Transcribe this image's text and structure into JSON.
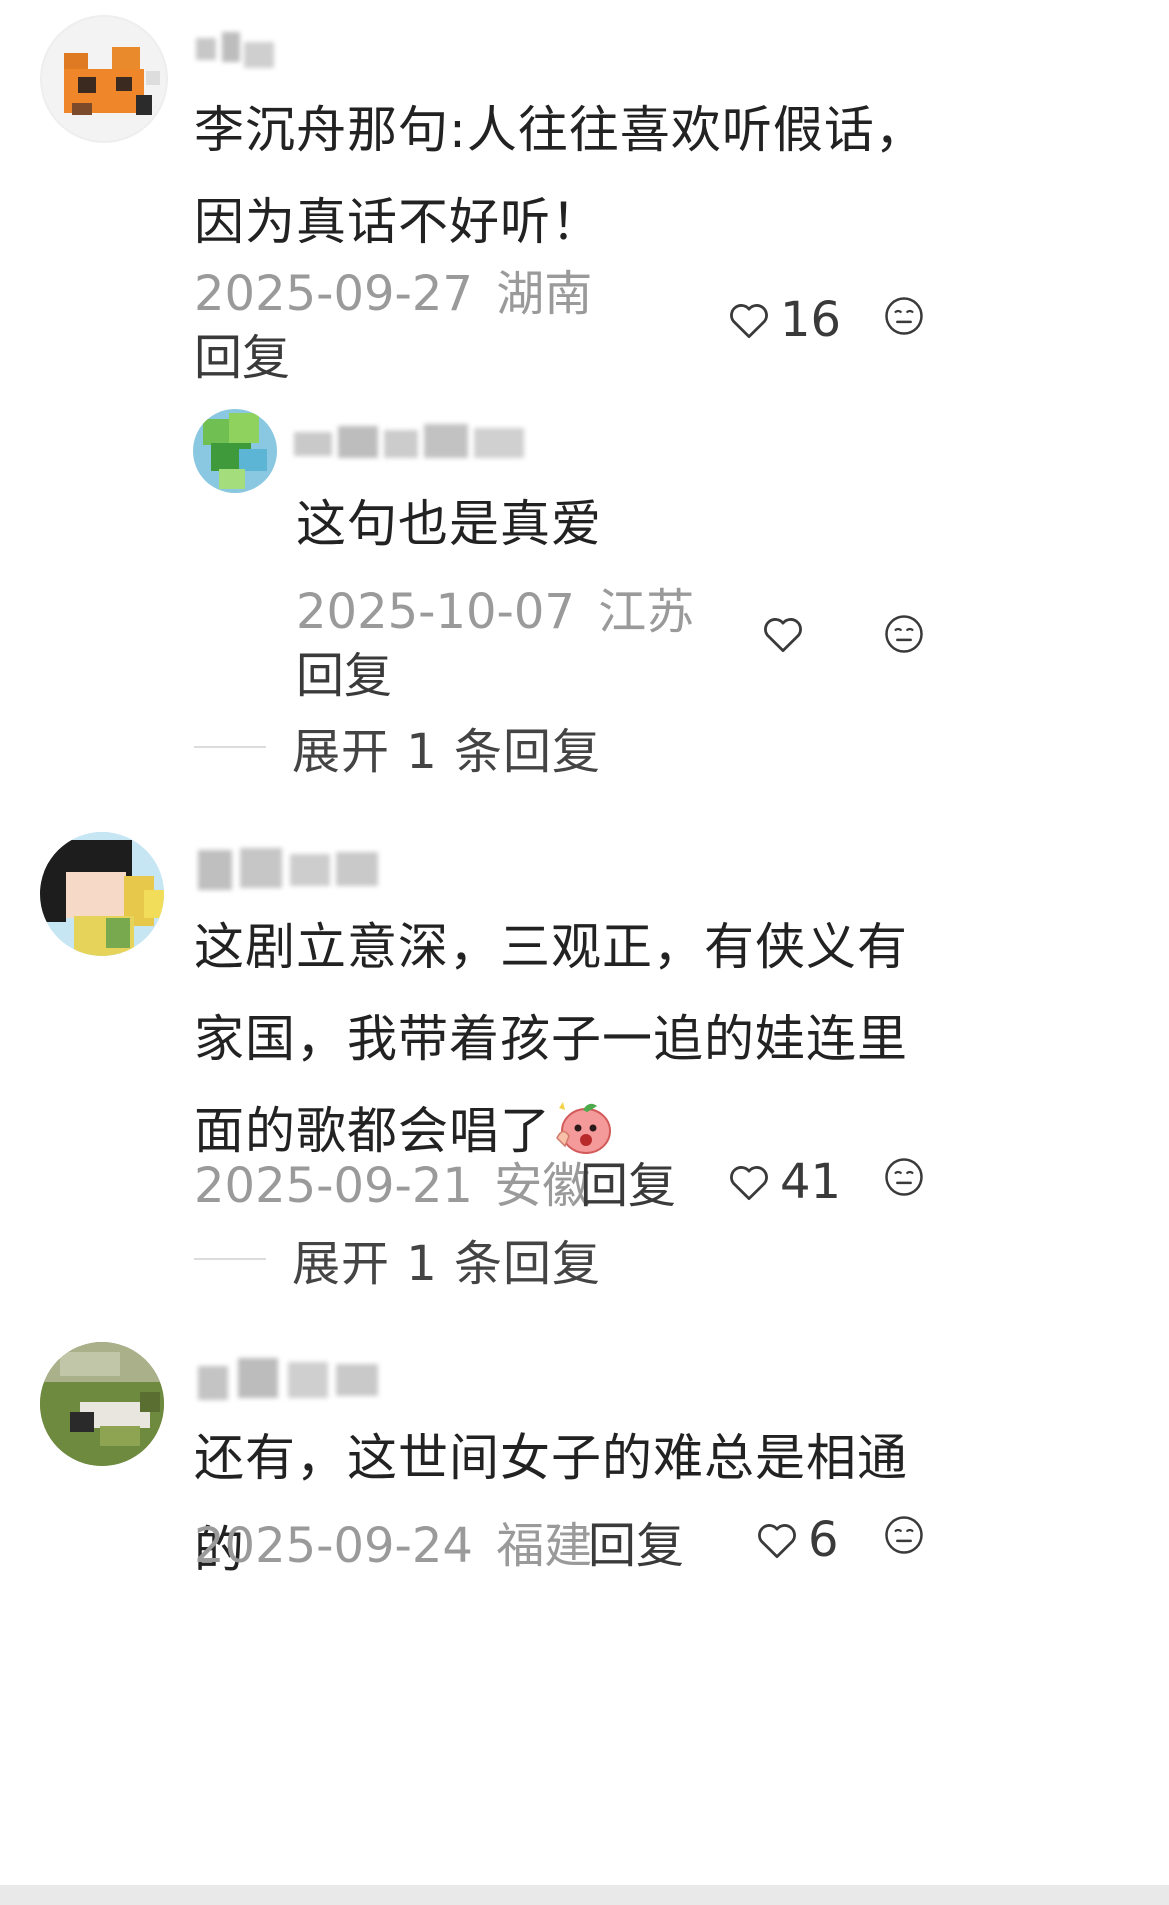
{
  "comments": [
    {
      "content": "李沉舟那句:人往往喜欢听假话，因为真话不好听！",
      "date": "2025-09-27",
      "region": "湖南",
      "reply_label": "回复",
      "likes": "16",
      "replies": [
        {
          "content": "这句也是真爱",
          "date": "2025-10-07",
          "region": "江苏",
          "reply_label": "回复",
          "likes": ""
        }
      ],
      "expand_label": "展开 1 条回复"
    },
    {
      "content": "这剧立意深，三观正，有侠义有家国，我带着孩子一追的娃连里面的歌都会唱了",
      "date": "2025-09-21",
      "region": "安徽",
      "reply_label": "回复",
      "likes": "41",
      "expand_label": "展开 1 条回复"
    },
    {
      "content": "还有，这世间女子的难总是相通的",
      "date": "2025-09-24",
      "region": "福建",
      "reply_label": "回复",
      "likes": "6"
    }
  ],
  "icons": {
    "like": "heart-outline-icon",
    "emoji": "neutral-face-icon",
    "sticker": "shocked-peach-sticker"
  },
  "colors": {
    "meta": "#9a9a9a",
    "text": "#222222",
    "icon": "#3a3a3a"
  }
}
